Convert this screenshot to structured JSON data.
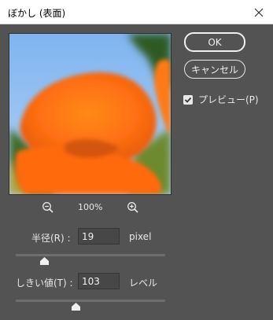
{
  "window": {
    "title": "ぼかし (表面)"
  },
  "buttons": {
    "ok": "OK",
    "cancel": "キャンセル"
  },
  "preview_checkbox": {
    "label": "プレビュー(P)",
    "checked": true
  },
  "zoom": {
    "level": "100%"
  },
  "radius": {
    "label": "半径(R) :",
    "value": "19",
    "unit": "pixel",
    "slider_fraction": 0.19
  },
  "threshold": {
    "label": "しきい値(T) :",
    "value": "103",
    "unit": "レベル",
    "slider_fraction": 0.4
  },
  "colors": {
    "panel": "#535353",
    "text": "#e8e8e8",
    "flower": "#ff7a10",
    "sky": "#86b8ef"
  }
}
